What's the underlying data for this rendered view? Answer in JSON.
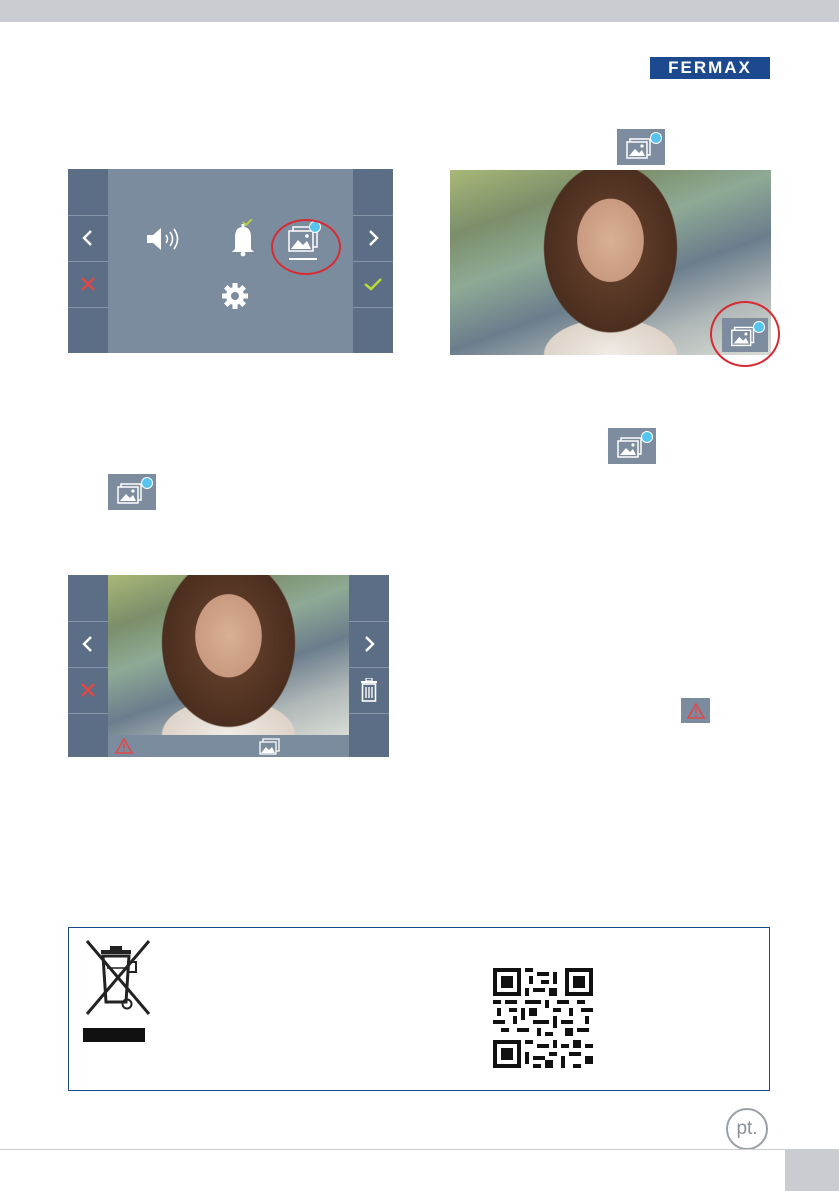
{
  "header": {
    "brand": "FERMAX"
  },
  "menu_screen": {
    "icons": [
      "volume-icon",
      "bell-icon",
      "gallery-icon",
      "settings-icon"
    ],
    "left_buttons": [
      "chevron-left-icon",
      "close-icon"
    ],
    "right_buttons": [
      "chevron-right-icon",
      "check-icon"
    ]
  },
  "viewer_screen": {
    "left_buttons": [
      "chevron-left-icon",
      "close-icon"
    ],
    "right_buttons": [
      "chevron-right-icon",
      "trash-icon"
    ],
    "status_icons": [
      "warning-icon",
      "gallery-icon"
    ]
  },
  "colors": {
    "brand": "#1d4a8f",
    "screen": "#7c8c9f",
    "side_panel": "#5b6e85",
    "highlight_circle": "#d72b33",
    "cancel": "#e04848",
    "confirm": "#b9d83a",
    "notification_dot": "#55c4ee"
  },
  "footer": {
    "language_badge": "pt."
  }
}
